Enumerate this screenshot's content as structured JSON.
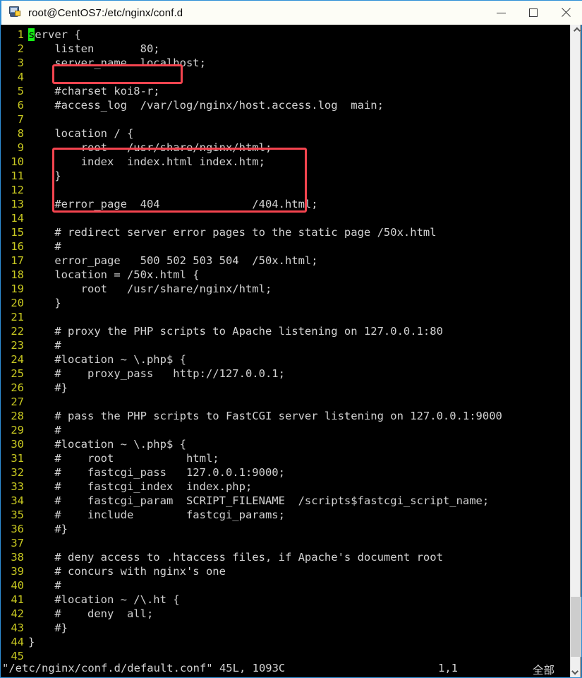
{
  "window": {
    "title": "root@CentOS7:/etc/nginx/conf.d",
    "icon": "putty-terminal-icon",
    "controls": {
      "minimize": "minimize-icon",
      "maximize": "maximize-icon",
      "close": "close-icon"
    }
  },
  "editor": {
    "app": "vim",
    "colors": {
      "background": "#000000",
      "line_number": "#c8c821",
      "text": "#d2d2d2",
      "cursor": "#16f016",
      "annotation": "#f4444f"
    },
    "cursor": {
      "line": 1,
      "column": 1,
      "char": "s"
    },
    "lines": [
      {
        "n": "1",
        "text": "server {"
      },
      {
        "n": "2",
        "text": "    listen       80;"
      },
      {
        "n": "3",
        "text": "    server_name  localhost;"
      },
      {
        "n": "4",
        "text": ""
      },
      {
        "n": "5",
        "text": "    #charset koi8-r;"
      },
      {
        "n": "6",
        "text": "    #access_log  /var/log/nginx/host.access.log  main;"
      },
      {
        "n": "7",
        "text": ""
      },
      {
        "n": "8",
        "text": "    location / {"
      },
      {
        "n": "9",
        "text": "        root   /usr/share/nginx/html;"
      },
      {
        "n": "10",
        "text": "        index  index.html index.htm;"
      },
      {
        "n": "11",
        "text": "    }"
      },
      {
        "n": "12",
        "text": ""
      },
      {
        "n": "13",
        "text": "    #error_page  404              /404.html;"
      },
      {
        "n": "14",
        "text": ""
      },
      {
        "n": "15",
        "text": "    # redirect server error pages to the static page /50x.html"
      },
      {
        "n": "16",
        "text": "    #"
      },
      {
        "n": "17",
        "text": "    error_page   500 502 503 504  /50x.html;"
      },
      {
        "n": "18",
        "text": "    location = /50x.html {"
      },
      {
        "n": "19",
        "text": "        root   /usr/share/nginx/html;"
      },
      {
        "n": "20",
        "text": "    }"
      },
      {
        "n": "21",
        "text": ""
      },
      {
        "n": "22",
        "text": "    # proxy the PHP scripts to Apache listening on 127.0.0.1:80"
      },
      {
        "n": "23",
        "text": "    #"
      },
      {
        "n": "24",
        "text": "    #location ~ \\.php$ {"
      },
      {
        "n": "25",
        "text": "    #    proxy_pass   http://127.0.0.1;"
      },
      {
        "n": "26",
        "text": "    #}"
      },
      {
        "n": "27",
        "text": ""
      },
      {
        "n": "28",
        "text": "    # pass the PHP scripts to FastCGI server listening on 127.0.0.1:9000"
      },
      {
        "n": "29",
        "text": "    #"
      },
      {
        "n": "30",
        "text": "    #location ~ \\.php$ {"
      },
      {
        "n": "31",
        "text": "    #    root           html;"
      },
      {
        "n": "32",
        "text": "    #    fastcgi_pass   127.0.0.1:9000;"
      },
      {
        "n": "33",
        "text": "    #    fastcgi_index  index.php;"
      },
      {
        "n": "34",
        "text": "    #    fastcgi_param  SCRIPT_FILENAME  /scripts$fastcgi_script_name;"
      },
      {
        "n": "35",
        "text": "    #    include        fastcgi_params;"
      },
      {
        "n": "36",
        "text": "    #}"
      },
      {
        "n": "37",
        "text": ""
      },
      {
        "n": "38",
        "text": "    # deny access to .htaccess files, if Apache's document root"
      },
      {
        "n": "39",
        "text": "    # concurs with nginx's one"
      },
      {
        "n": "40",
        "text": "    #"
      },
      {
        "n": "41",
        "text": "    #location ~ /\\.ht {"
      },
      {
        "n": "42",
        "text": "    #    deny  all;"
      },
      {
        "n": "43",
        "text": "    #}"
      },
      {
        "n": "44",
        "text": "}"
      },
      {
        "n": "45",
        "text": ""
      }
    ]
  },
  "status": {
    "file": "\"/etc/nginx/conf.d/default.conf\" 45L, 1093C",
    "position": "1,1",
    "view": "全部"
  },
  "annotations": [
    {
      "id": "anno-listen",
      "label": "listen-directive-highlight"
    },
    {
      "id": "anno-location",
      "label": "location-block-highlight"
    }
  ],
  "scrollbar": {
    "up_arrow": "chevron-up-icon",
    "down_arrow": "chevron-down-icon"
  }
}
